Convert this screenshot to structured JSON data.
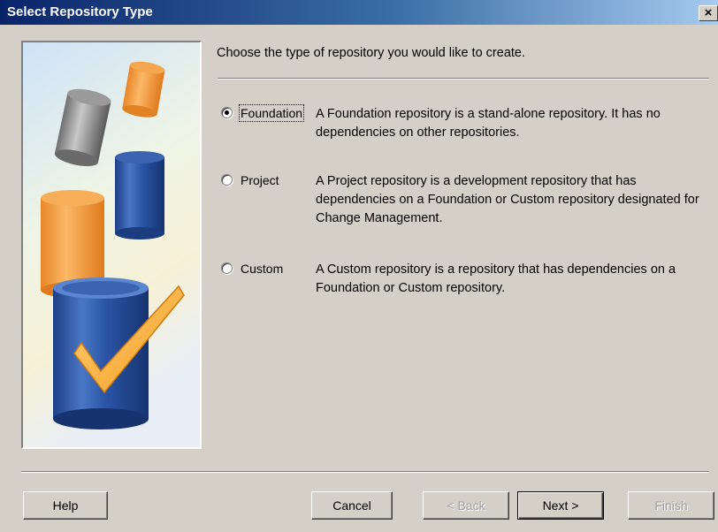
{
  "window": {
    "title": "Select Repository Type",
    "close_label": "×"
  },
  "prompt": "Choose the type of repository you would like to create.",
  "options": [
    {
      "label": "Foundation",
      "selected": true,
      "description": "A Foundation repository is a stand-alone repository. It has no dependencies on other repositories."
    },
    {
      "label": "Project",
      "selected": false,
      "description": "A Project repository is a development repository that has dependencies on a Foundation or Custom repository designated for Change Management."
    },
    {
      "label": "Custom",
      "selected": false,
      "description": "A Custom repository is a repository that has dependencies on a Foundation or Custom repository."
    }
  ],
  "buttons": {
    "help": "Help",
    "cancel": "Cancel",
    "back": "< Back",
    "next": "Next >",
    "finish": "Finish"
  },
  "colors": {
    "titlebar_start": "#0a246a",
    "titlebar_end": "#a6caf0",
    "dialog_face": "#d4d0c8"
  },
  "illustration": {
    "icons": [
      "gray-cylinder-icon",
      "orange-cylinder-icon",
      "blue-cylinder-icon",
      "checkmark-icon"
    ]
  }
}
